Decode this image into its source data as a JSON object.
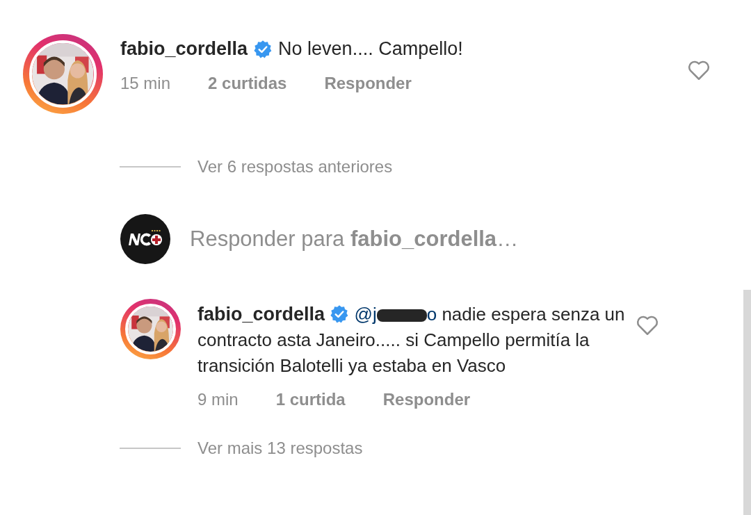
{
  "comments": [
    {
      "username": "fabio_cordella",
      "verified": true,
      "text": "No leven.... Campello!",
      "time": "15 min",
      "likes": "2 curtidas",
      "reply": "Responder",
      "liked": false,
      "view_replies": "Ver 6 respostas anteriores"
    }
  ],
  "composer": {
    "placeholder_prefix": "Responder para",
    "placeholder_user": "fabio_cordella",
    "ellipsis": "…"
  },
  "reply": {
    "username": "fabio_cordella",
    "verified": true,
    "mention_start": "@j",
    "mention_end": "o",
    "text": "nadie espera senza un contracto asta Janeiro..... si Campello permitía la transición Balotelli ya estaba en Vasco",
    "time": "9 min",
    "likes": "1 curtida",
    "reply": "Responder",
    "liked": false,
    "more_replies": "Ver mais 13 respostas"
  }
}
